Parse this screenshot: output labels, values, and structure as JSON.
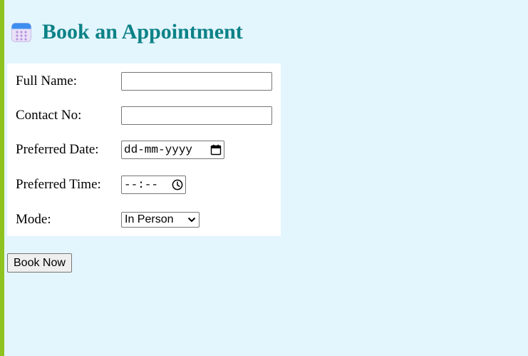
{
  "header": {
    "title": "Book an Appointment",
    "icon": "calendar-icon"
  },
  "form": {
    "full_name": {
      "label": "Full Name:",
      "value": "",
      "placeholder": ""
    },
    "contact_no": {
      "label": "Contact No:",
      "value": "",
      "placeholder": ""
    },
    "preferred_date": {
      "label": "Preferred Date:",
      "placeholder": "dd-mm-yyyy",
      "icon": "calendar-picker-icon"
    },
    "preferred_time": {
      "label": "Preferred Time:",
      "placeholder": "--:--",
      "icon": "clock-icon"
    },
    "mode": {
      "label": "Mode:",
      "selected": "In Person",
      "icon": "chevron-down-icon"
    }
  },
  "actions": {
    "submit_label": "Book Now"
  },
  "colors": {
    "background": "#e3f5fd",
    "accent_bar": "#8fc31f",
    "title": "#0b8286"
  }
}
